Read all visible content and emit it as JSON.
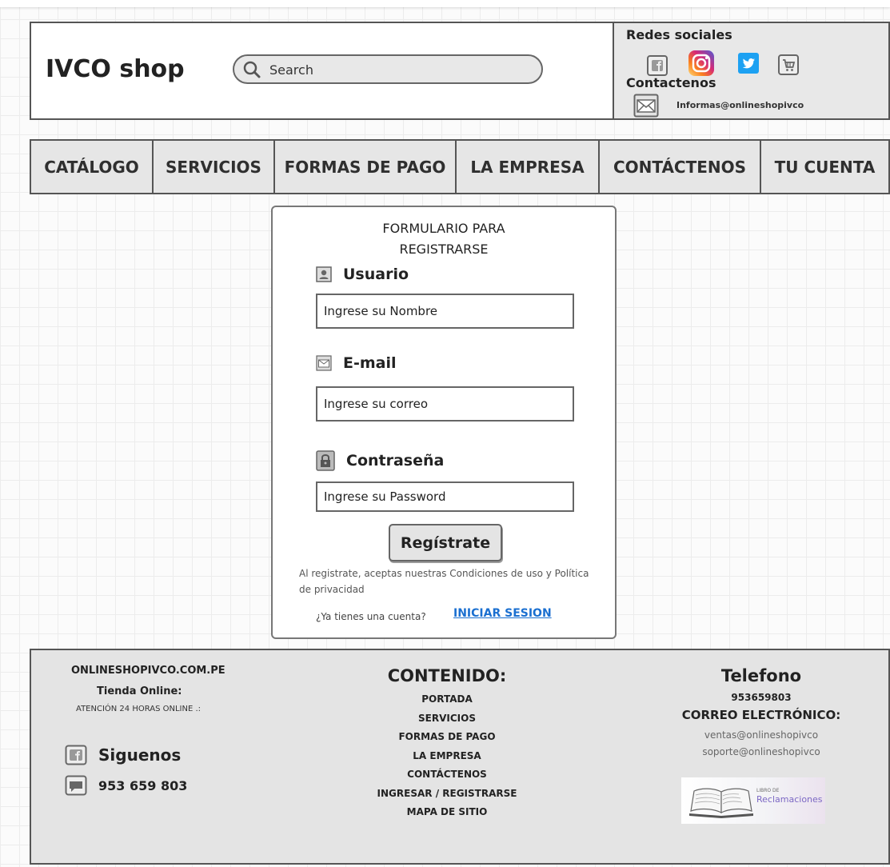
{
  "header": {
    "logo": "IVCO shop",
    "search_placeholder": "Search",
    "social_title": "Redes sociales",
    "social_icons": [
      "facebook-icon",
      "instagram-icon",
      "twitter-icon",
      "cart-icon"
    ],
    "contact_title": "Contactenos",
    "contact_email": "Informas@onlineshopivco"
  },
  "nav": {
    "items": [
      "CATÁLOGO",
      "SERVICIOS",
      "FORMAS DE PAGO",
      "LA EMPRESA",
      "CONTÁCTENOS",
      "TU CUENTA"
    ]
  },
  "form": {
    "title_line1": "FORMULARIO PARA",
    "title_line2": "REGISTRARSE",
    "user_label": "Usuario",
    "user_placeholder": "Ingrese su Nombre",
    "email_label": "E-mail",
    "email_placeholder": "Ingrese su correo",
    "password_label": "Contraseña",
    "password_placeholder": "Ingrese su Password",
    "submit": "Regístrate",
    "terms": "Al registrate, aceptas nuestras Condiciones de uso y Política de privacidad",
    "have_account": "¿Ya tienes una cuenta?",
    "login_link": "INICIAR SESION"
  },
  "footer": {
    "domain": "ONLINESHOPIVCO.COM.PE",
    "store": "Tienda Online:",
    "hours": "ATENCIÓN 24 HORAS ONLINE .:",
    "follow": "Siguenos",
    "phone_left": "953 659 803",
    "content_title": "CONTENIDO:",
    "links": [
      "PORTADA",
      "SERVICIOS",
      "FORMAS DE PAGO",
      "LA EMPRESA",
      "CONTÁCTENOS",
      "INGRESAR / REGISTRARSE",
      "MAPA DE SITIO"
    ],
    "phone_title": "Telefono",
    "phone_number": "953659803",
    "email_title": "CORREO ELECTRÓNICO:",
    "emails": [
      "ventas@onlineshopivco",
      "soporte@onlineshopivco"
    ],
    "book_small": "LIBRO DE",
    "book_big": "Reclamaciones"
  },
  "colors": {
    "link_blue": "#1a6fd0",
    "twitter_blue": "#1da1f2",
    "panel_gray": "#e6e6e6",
    "border_gray": "#555555"
  }
}
